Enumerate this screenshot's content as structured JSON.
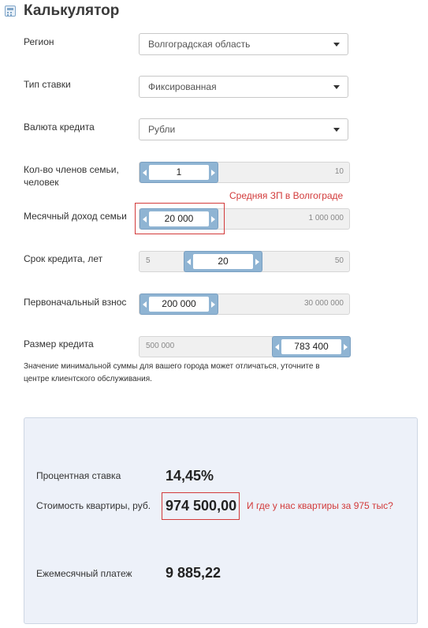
{
  "title": "Калькулятор",
  "fields": {
    "region": {
      "label": "Регион",
      "value": "Волгоградская область"
    },
    "rate_type": {
      "label": "Тип ставки",
      "value": "Фиксированная"
    },
    "currency": {
      "label": "Валюта кредита",
      "value": "Рубли"
    }
  },
  "sliders": {
    "family": {
      "label": "Кол-во членов семьи, человек",
      "value": "1",
      "min": "",
      "max": "10"
    },
    "income": {
      "label": "Месячный доход семьи",
      "value": "20 000",
      "min": "",
      "max": "1 000 000"
    },
    "term": {
      "label": "Срок кредита, лет",
      "value": "20",
      "min": "5",
      "max": "50"
    },
    "down_payment": {
      "label": "Первоначальный взнос",
      "value": "200 000",
      "min": "",
      "max": "30 000 000"
    },
    "loan_size": {
      "label": "Размер кредита",
      "value": "783 400",
      "min": "500 000",
      "max": ""
    }
  },
  "annotations": {
    "salary": "Средняя ЗП в Волгограде",
    "price": "И где у нас квартиры за 975 тыс?"
  },
  "note": "Значение минимальной суммы для вашего города может отличаться, уточните в центре клиентского обслуживания.",
  "results": {
    "rate": {
      "label": "Процентная ставка",
      "value": "14,45%"
    },
    "price": {
      "label": "Стоимость квартиры, руб.",
      "value": "974 500,00"
    },
    "monthly": {
      "label": "Ежемесячный платеж",
      "value": "9 885,22"
    }
  },
  "colors": {
    "accent": "#8fb4d3",
    "annotation": "#d23a3a",
    "panel": "#edf1f9"
  }
}
